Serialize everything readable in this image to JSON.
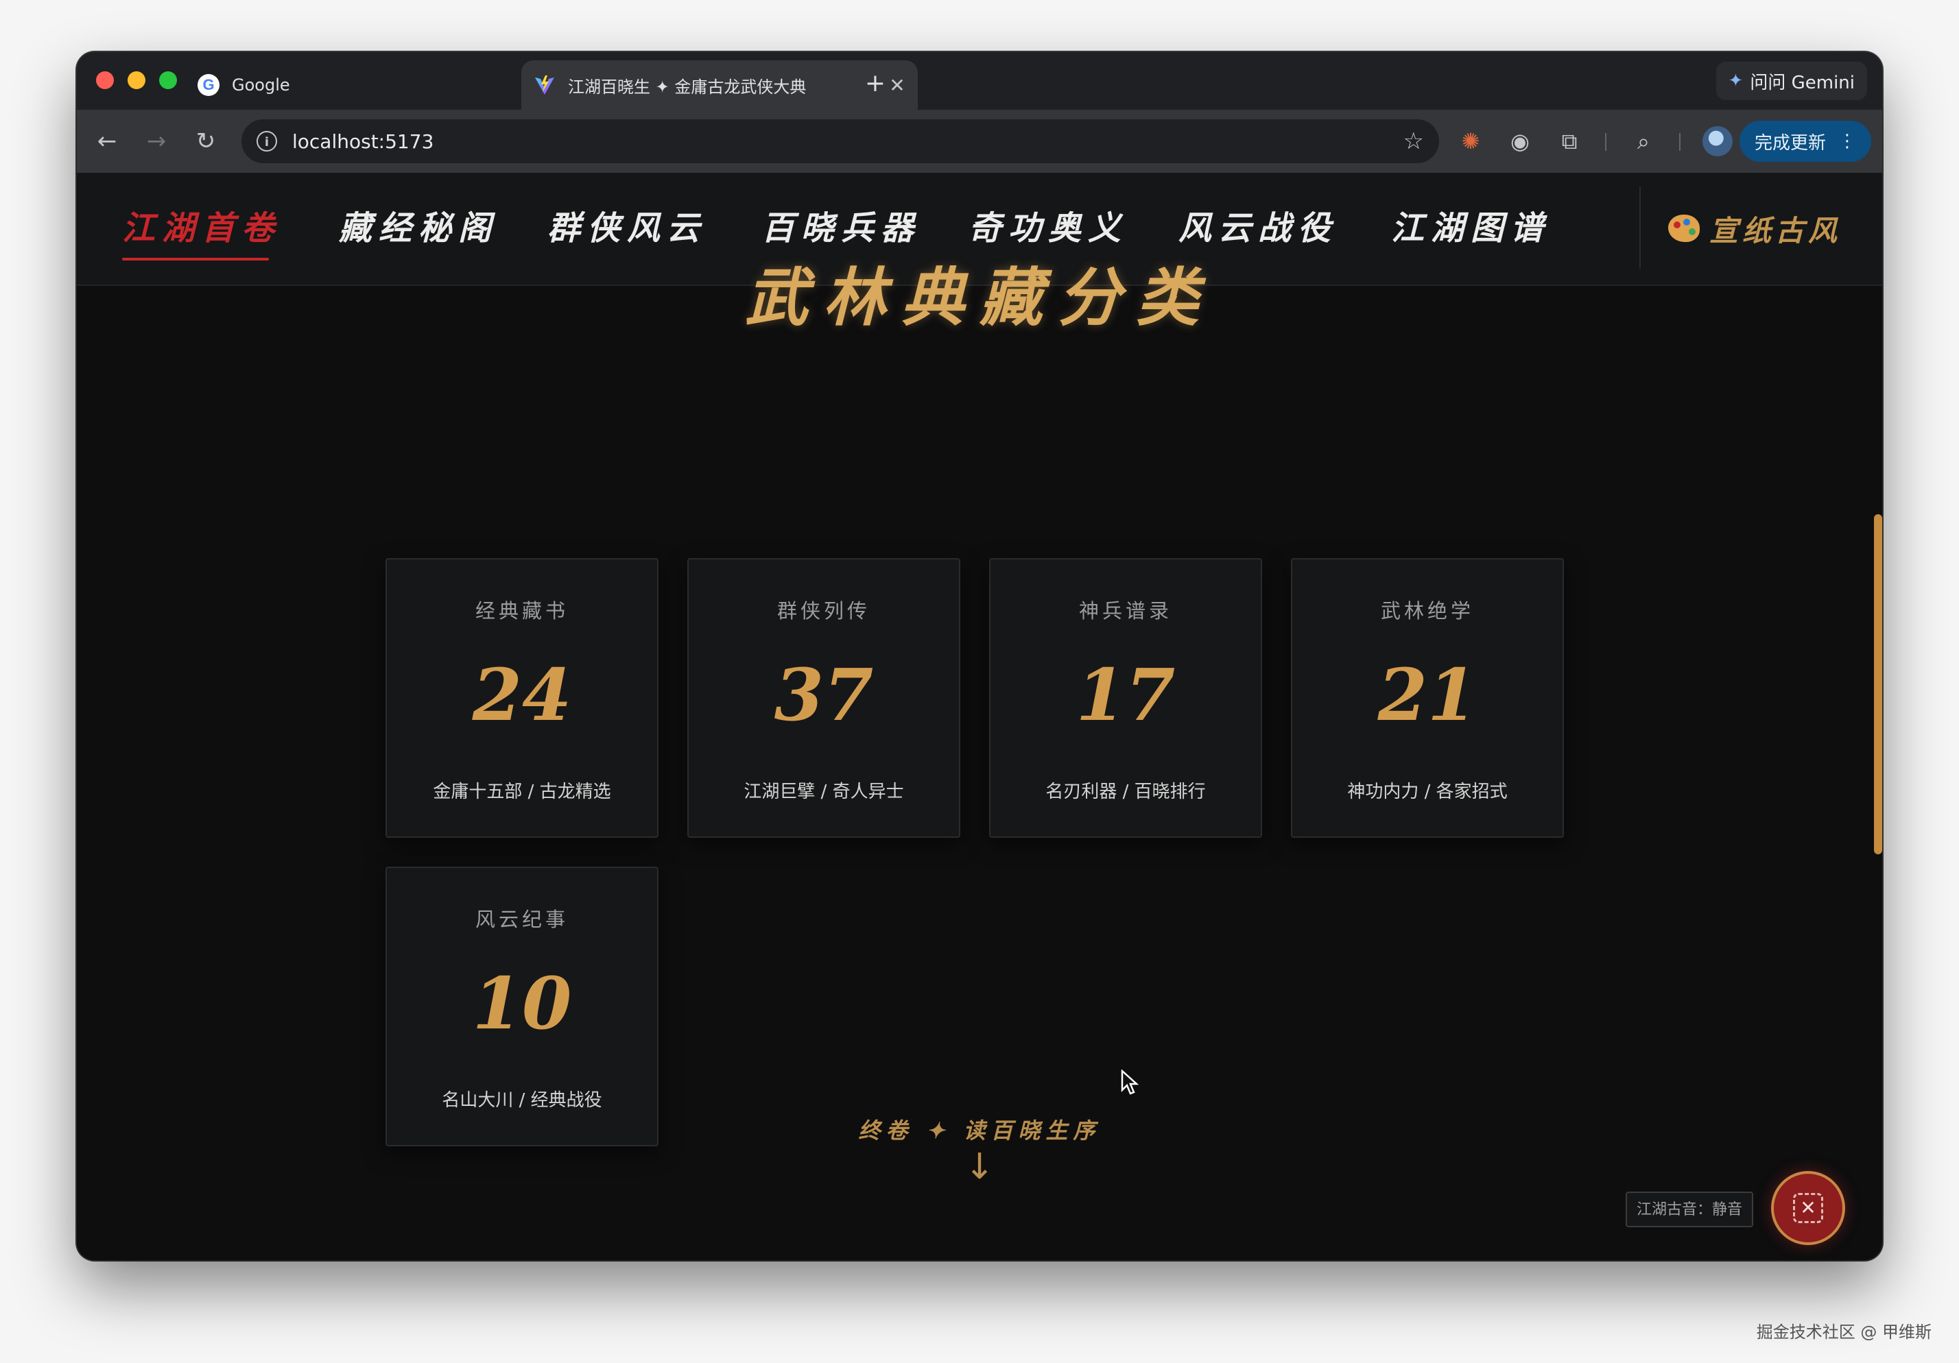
{
  "browser": {
    "tabs": [
      {
        "title": "Google",
        "favicon": "google-icon",
        "active": false
      },
      {
        "title": "江湖百晓生 ✦ 金庸古龙武侠大典",
        "favicon": "vite-icon",
        "active": true
      }
    ],
    "new_tab": "+",
    "gemini_label": "问问 Gemini",
    "url": "localhost:5173",
    "update_label": "完成更新"
  },
  "nav": {
    "items": [
      {
        "label": "江湖首卷",
        "active": true
      },
      {
        "label": "藏经秘阁",
        "active": false
      },
      {
        "label": "群侠风云",
        "active": false
      },
      {
        "label": "百晓兵器",
        "active": false
      },
      {
        "label": "奇功奥义",
        "active": false
      },
      {
        "label": "风云战役",
        "active": false
      },
      {
        "label": "江湖图谱",
        "active": false
      }
    ],
    "theme_label": "宣纸古风",
    "accent_color": "#c8262b"
  },
  "main": {
    "title": "武林典藏分类",
    "cards": [
      {
        "label": "经典藏书",
        "number": "24",
        "desc": "金庸十五部 / 古龙精选"
      },
      {
        "label": "群侠列传",
        "number": "37",
        "desc": "江湖巨擘 / 奇人异士"
      },
      {
        "label": "神兵谱录",
        "number": "17",
        "desc": "名刃利器 / 百晓排行"
      },
      {
        "label": "武林绝学",
        "number": "21",
        "desc": "神功内力 / 各家招式"
      },
      {
        "label": "风云纪事",
        "number": "10",
        "desc": "名山大川 / 经典战役"
      }
    ],
    "read_prompt": "终卷 ✦ 读百晓生序",
    "read_arrow": "↓",
    "gold_color": "#d29c4e"
  },
  "music": {
    "label": "江湖古音：静音",
    "button_glyph": "✕"
  },
  "watermark": "掘金技术社区 @ 甲维斯"
}
